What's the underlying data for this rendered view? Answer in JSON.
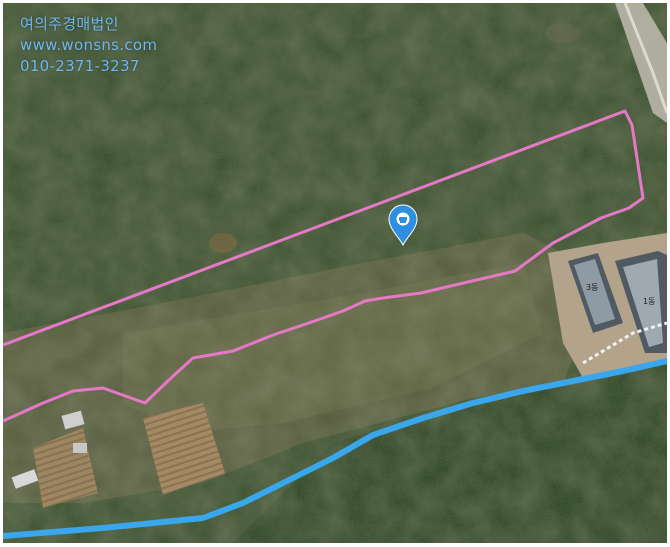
{
  "map": {
    "type": "satellite",
    "colors": {
      "parcel_outline": "#e678c8",
      "stream": "#3aa6ec",
      "marker": "#2e8ee0",
      "watermark": "#6fb6f2"
    },
    "marker_icon": "location-pin-icon"
  },
  "watermark": {
    "company": "여의주경매법인",
    "website": "www.wonsns.com",
    "phone": "010-2371-3237"
  },
  "buildings": {
    "left_label": "3동",
    "right_label": "1동"
  }
}
